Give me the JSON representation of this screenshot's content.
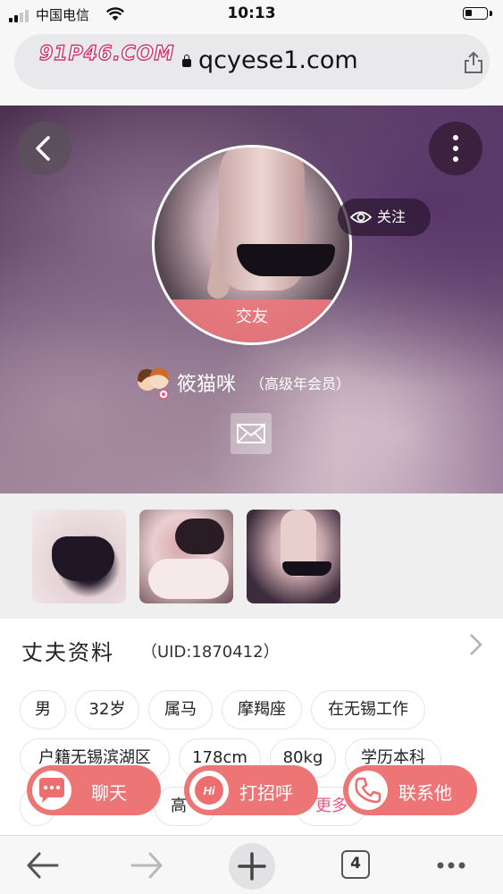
{
  "status_bar": {
    "carrier": "中国电信",
    "time": "10:13",
    "signal_bars_active": 2,
    "battery_level": 0.3
  },
  "browser": {
    "watermark": "91P46.COM",
    "url": "qcyese1.com",
    "icons": {
      "lock": "lock-icon",
      "share": "share-icon"
    }
  },
  "hero": {
    "back_icon": "chevron-left-icon",
    "more_icon": "more-vertical-icon",
    "avatar_label": "交友",
    "follow_label": "关注",
    "follow_icon": "eye-icon",
    "username": "筱猫咪",
    "member_level": "（高级年会员）",
    "mail_icon": "envelope-icon"
  },
  "gallery": {
    "photos": [
      "photo-1",
      "photo-2",
      "photo-3"
    ]
  },
  "profile": {
    "title": "丈夫资料",
    "uid": "（UID:1870412）",
    "tags": [
      "男",
      "32岁",
      "属马",
      "摩羯座",
      "在无锡工作",
      "户籍无锡滨湖区",
      "178cm",
      "80kg",
      "学历本科",
      "高",
      "更多"
    ]
  },
  "actions": {
    "chat": "聊天",
    "greet": "打招呼",
    "greet_icon_text": "Hi",
    "contact": "联系他"
  },
  "toolbar": {
    "tab_count": "4"
  },
  "colors": {
    "accent": "#ec6e6e",
    "more_link": "#e85a83"
  }
}
